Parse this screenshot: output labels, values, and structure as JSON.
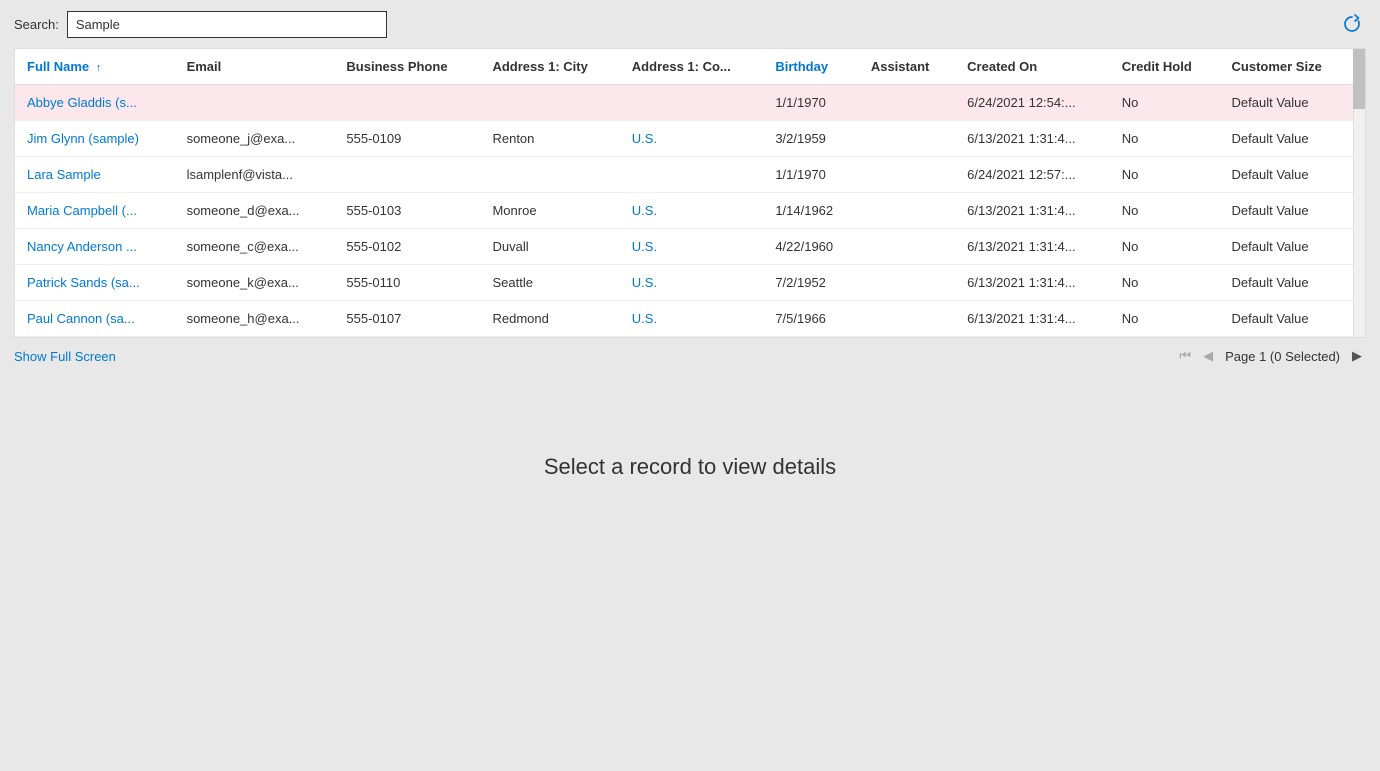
{
  "search": {
    "label": "Search:",
    "value": "Sample",
    "placeholder": ""
  },
  "refresh_icon": "↻",
  "table": {
    "columns": [
      {
        "key": "full_name",
        "label": "Full Name",
        "sorted": true,
        "sort_dir": "↑"
      },
      {
        "key": "email",
        "label": "Email",
        "sorted": false
      },
      {
        "key": "business_phone",
        "label": "Business Phone",
        "sorted": false
      },
      {
        "key": "address_city",
        "label": "Address 1: City",
        "sorted": false
      },
      {
        "key": "address_country",
        "label": "Address 1: Co...",
        "sorted": false
      },
      {
        "key": "birthday",
        "label": "Birthday",
        "sorted": false,
        "blue": true
      },
      {
        "key": "assistant",
        "label": "Assistant",
        "sorted": false
      },
      {
        "key": "created_on",
        "label": "Created On",
        "sorted": false
      },
      {
        "key": "credit_hold",
        "label": "Credit Hold",
        "sorted": false
      },
      {
        "key": "customer_size",
        "label": "Customer Size",
        "sorted": false
      }
    ],
    "rows": [
      {
        "full_name": "Abbye Gladdis (s...",
        "email": "",
        "business_phone": "",
        "address_city": "",
        "address_country": "",
        "birthday": "1/1/1970",
        "assistant": "",
        "created_on": "6/24/2021 12:54:...",
        "credit_hold": "No",
        "customer_size": "Default Value",
        "highlighted": true
      },
      {
        "full_name": "Jim Glynn (sample)",
        "email": "someone_j@exa...",
        "business_phone": "555-0109",
        "address_city": "Renton",
        "address_country": "U.S.",
        "birthday": "3/2/1959",
        "assistant": "",
        "created_on": "6/13/2021 1:31:4...",
        "credit_hold": "No",
        "customer_size": "Default Value",
        "highlighted": false
      },
      {
        "full_name": "Lara Sample",
        "email": "lsamplenf@vista...",
        "business_phone": "",
        "address_city": "",
        "address_country": "",
        "birthday": "1/1/1970",
        "assistant": "",
        "created_on": "6/24/2021 12:57:...",
        "credit_hold": "No",
        "customer_size": "Default Value",
        "highlighted": false
      },
      {
        "full_name": "Maria Campbell (...",
        "email": "someone_d@exa...",
        "business_phone": "555-0103",
        "address_city": "Monroe",
        "address_country": "U.S.",
        "birthday": "1/14/1962",
        "assistant": "",
        "created_on": "6/13/2021 1:31:4...",
        "credit_hold": "No",
        "customer_size": "Default Value",
        "highlighted": false
      },
      {
        "full_name": "Nancy Anderson ...",
        "email": "someone_c@exa...",
        "business_phone": "555-0102",
        "address_city": "Duvall",
        "address_country": "U.S.",
        "birthday": "4/22/1960",
        "assistant": "",
        "created_on": "6/13/2021 1:31:4...",
        "credit_hold": "No",
        "customer_size": "Default Value",
        "highlighted": false
      },
      {
        "full_name": "Patrick Sands (sa...",
        "email": "someone_k@exa...",
        "business_phone": "555-0110",
        "address_city": "Seattle",
        "address_country": "U.S.",
        "birthday": "7/2/1952",
        "assistant": "",
        "created_on": "6/13/2021 1:31:4...",
        "credit_hold": "No",
        "customer_size": "Default Value",
        "highlighted": false
      },
      {
        "full_name": "Paul Cannon (sa...",
        "email": "someone_h@exa...",
        "business_phone": "555-0107",
        "address_city": "Redmond",
        "address_country": "U.S.",
        "birthday": "7/5/1966",
        "assistant": "",
        "created_on": "6/13/2021 1:31:4...",
        "credit_hold": "No",
        "customer_size": "Default Value",
        "highlighted": false
      }
    ]
  },
  "bottom": {
    "show_full_screen": "Show Full Screen",
    "page_info": "Page 1 (0 Selected)"
  },
  "main_message": "Select a record to view details"
}
